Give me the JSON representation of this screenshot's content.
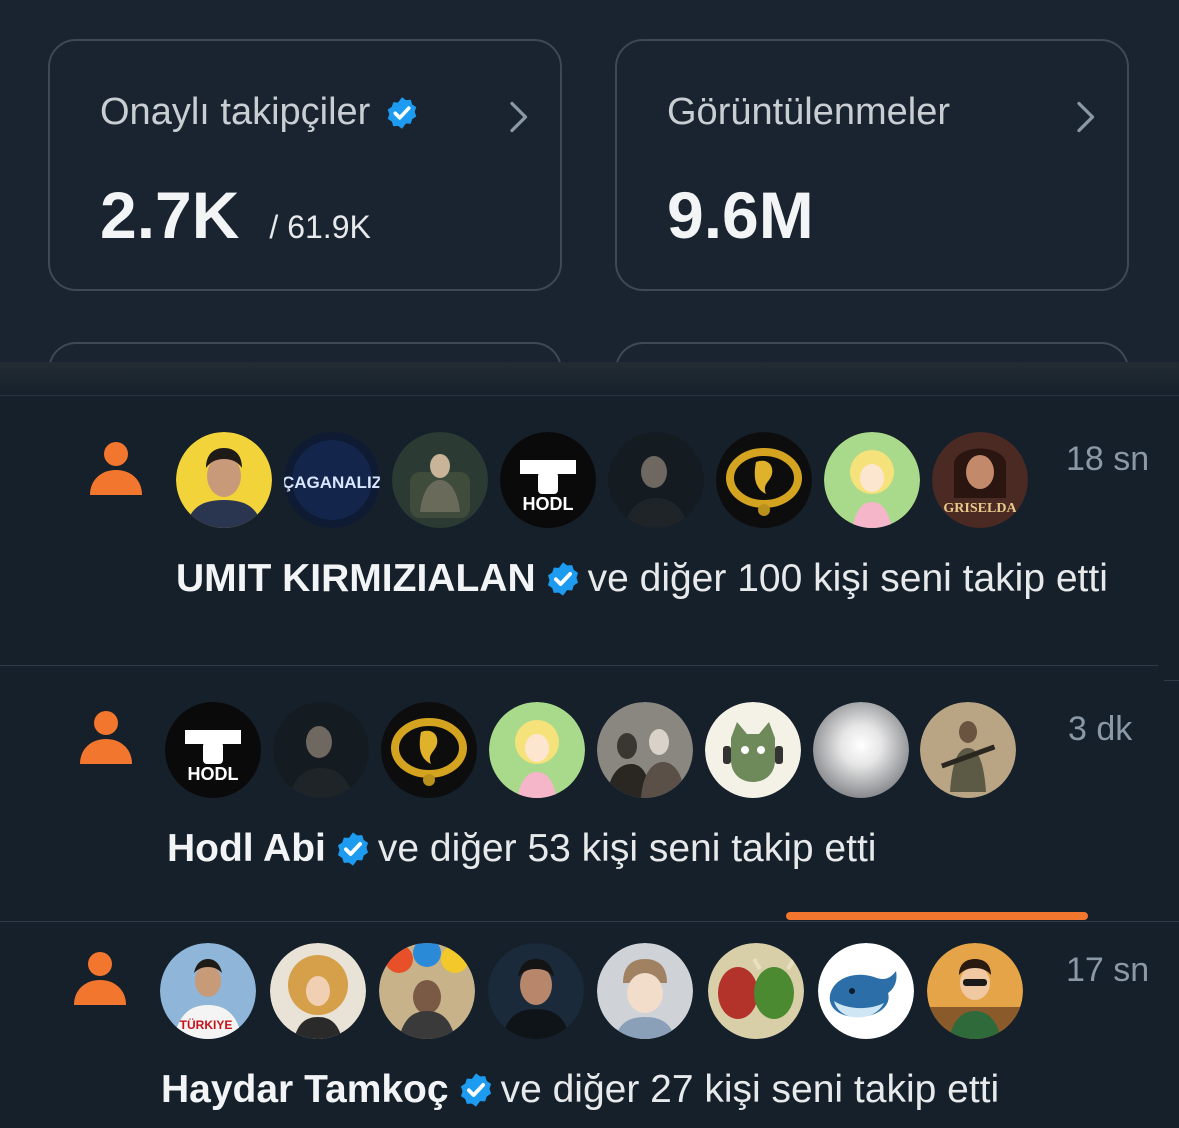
{
  "stats": {
    "verified_followers": {
      "title": "Onaylı takipçiler",
      "value": "2.7K",
      "sub": "/ 61.9K"
    },
    "impressions": {
      "title": "Görüntülenmeler",
      "value": "9.6M"
    }
  },
  "notifications": [
    {
      "time": "18 sn",
      "name": "UMIT KIRMIZIALAN",
      "text": "ve diğer 100 kişi seni takip etti",
      "avatars": [
        "avatar-man-yellow",
        "avatar-caganaliz",
        "avatar-armchair-man",
        "avatar-hodl",
        "avatar-dark-man",
        "avatar-gold-lion",
        "avatar-anime-girl",
        "avatar-griselda"
      ],
      "avatar_texts": {
        "caganaliz": "ÇAGANALIZ",
        "hodl": "HODL",
        "griselda": "GRISELDA"
      }
    },
    {
      "time": "3 dk",
      "name": "Hodl Abi",
      "text": "ve diğer 53 kişi seni takip etti",
      "avatars": [
        "avatar-hodl",
        "avatar-dark-man",
        "avatar-gold-lion",
        "avatar-anime-girl",
        "avatar-old-photo",
        "avatar-cat-headphones",
        "avatar-light-orb",
        "avatar-soldier"
      ],
      "avatar_texts": {
        "hodl": "HODL"
      }
    },
    {
      "time": "17 sn",
      "name": "Haydar Tamkoç",
      "text": "ve diğer 27 kişi seni takip etti",
      "avatars": [
        "avatar-turkiye-jersey",
        "avatar-curly-woman",
        "avatar-umbrellas",
        "avatar-man-smile",
        "avatar-child",
        "avatar-bear-bull",
        "avatar-whale",
        "avatar-cartoon-man"
      ],
      "avatar_texts": {
        "turkiye": "TÜRKIYE"
      }
    }
  ],
  "colors": {
    "accent": "#f2762e",
    "verified": "#1d9bf0",
    "background": "#15202b"
  }
}
